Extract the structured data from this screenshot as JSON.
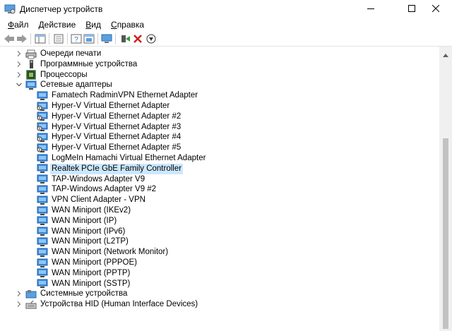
{
  "window": {
    "title": "Диспетчер устройств",
    "minimize_icon": "minimize-icon",
    "maximize_icon": "maximize-icon",
    "close_icon": "close-icon"
  },
  "menu": [
    {
      "label": "Файл",
      "underline": "Ф",
      "rest": "айл"
    },
    {
      "label": "Действие",
      "underline": "Д",
      "rest": "ействие"
    },
    {
      "label": "Вид",
      "underline": "В",
      "rest": "ид"
    },
    {
      "label": "Справка",
      "underline": "С",
      "rest": "правка"
    }
  ],
  "toolbar": {
    "icons": [
      "back-icon",
      "forward-icon",
      "properties-icon",
      "help-icon",
      "show-hidden-icon",
      "console-tree-icon",
      "scan-hardware-icon",
      "update-driver-icon",
      "uninstall-icon",
      "disable-device-icon"
    ]
  },
  "tree": {
    "categories_top": [
      {
        "label": "Очереди печати",
        "icon": "print-queue-icon"
      },
      {
        "label": "Программные устройства",
        "icon": "software-device-icon"
      },
      {
        "label": "Процессоры",
        "icon": "processor-icon"
      }
    ],
    "network": {
      "label": "Сетевые адаптеры",
      "icon": "network-adapter-icon",
      "expanded": true,
      "selected_item": "Realtek PCIe GbE Family Controller",
      "children": [
        "Famatech RadminVPN Ethernet Adapter",
        "Hyper-V Virtual Ethernet Adapter",
        "Hyper-V Virtual Ethernet Adapter #2",
        "Hyper-V Virtual Ethernet Adapter #3",
        "Hyper-V Virtual Ethernet Adapter #4",
        "Hyper-V Virtual Ethernet Adapter #5",
        "LogMeIn Hamachi Virtual Ethernet Adapter",
        "Realtek PCIe GbE Family Controller",
        "TAP-Windows Adapter V9",
        "TAP-Windows Adapter V9 #2",
        "VPN Client Adapter - VPN",
        "WAN Miniport (IKEv2)",
        "WAN Miniport (IP)",
        "WAN Miniport (IPv6)",
        "WAN Miniport (L2TP)",
        "WAN Miniport (Network Monitor)",
        "WAN Miniport (PPPOE)",
        "WAN Miniport (PPTP)",
        "WAN Miniport (SSTP)"
      ]
    },
    "categories_bottom": [
      {
        "label": "Системные устройства",
        "icon": "system-device-icon"
      },
      {
        "label": "Устройства HID (Human Interface Devices)",
        "icon": "hid-device-icon"
      }
    ]
  },
  "colors": {
    "selection": "#cce8ff",
    "adapter_icon": "#2f7fd6"
  }
}
